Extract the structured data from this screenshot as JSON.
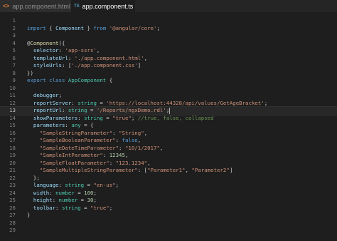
{
  "tabs": [
    {
      "label": "app.component.html",
      "icon": "html-file-icon",
      "icon_glyph": "<>",
      "active": false
    },
    {
      "label": "app.component.ts",
      "icon": "typescript-file-icon",
      "icon_glyph": "TS",
      "active": true
    }
  ],
  "editor": {
    "current_line": 13,
    "lines": [
      {
        "n": "1",
        "tokens": []
      },
      {
        "n": "2",
        "tokens": [
          {
            "t": "import",
            "c": "kw"
          },
          {
            "t": " { ",
            "c": ""
          },
          {
            "t": "Component",
            "c": "prop"
          },
          {
            "t": " } ",
            "c": ""
          },
          {
            "t": "from",
            "c": "kw"
          },
          {
            "t": " ",
            "c": ""
          },
          {
            "t": "'@angular/core'",
            "c": "str"
          },
          {
            "t": ";",
            "c": ""
          }
        ]
      },
      {
        "n": "3",
        "tokens": []
      },
      {
        "n": "4",
        "tokens": [
          {
            "t": "@",
            "c": ""
          },
          {
            "t": "Component",
            "c": "dec"
          },
          {
            "t": "({",
            "c": ""
          }
        ]
      },
      {
        "n": "5",
        "tokens": [
          {
            "t": "  selector",
            "c": "prop"
          },
          {
            "t": ": ",
            "c": ""
          },
          {
            "t": "'app-ssrs'",
            "c": "str"
          },
          {
            "t": ",",
            "c": ""
          }
        ]
      },
      {
        "n": "6",
        "tokens": [
          {
            "t": "  templateUrl",
            "c": "prop"
          },
          {
            "t": ": ",
            "c": ""
          },
          {
            "t": "'./app.component.html'",
            "c": "str"
          },
          {
            "t": ",",
            "c": ""
          }
        ]
      },
      {
        "n": "7",
        "tokens": [
          {
            "t": "  styleUrls",
            "c": "prop"
          },
          {
            "t": ": [",
            "c": ""
          },
          {
            "t": "'./app.component.css'",
            "c": "str"
          },
          {
            "t": "]",
            "c": ""
          }
        ]
      },
      {
        "n": "8",
        "tokens": [
          {
            "t": "})",
            "c": ""
          }
        ]
      },
      {
        "n": "9",
        "tokens": [
          {
            "t": "export",
            "c": "kw"
          },
          {
            "t": " ",
            "c": ""
          },
          {
            "t": "class",
            "c": "kw"
          },
          {
            "t": " ",
            "c": ""
          },
          {
            "t": "AppComponent",
            "c": "cls"
          },
          {
            "t": " {",
            "c": ""
          }
        ]
      },
      {
        "n": "10",
        "tokens": []
      },
      {
        "n": "11",
        "tokens": [
          {
            "t": "  debugger",
            "c": "prop"
          },
          {
            "t": ";",
            "c": ""
          }
        ]
      },
      {
        "n": "12",
        "tokens": [
          {
            "t": "  reportServer",
            "c": "prop"
          },
          {
            "t": ": ",
            "c": ""
          },
          {
            "t": "string",
            "c": "cls"
          },
          {
            "t": " = ",
            "c": ""
          },
          {
            "t": "'https://localhost:44328/api/values/GetAgeBracket'",
            "c": "str"
          },
          {
            "t": ";",
            "c": ""
          }
        ]
      },
      {
        "n": "13",
        "tokens": [
          {
            "t": "  reportUrl",
            "c": "prop"
          },
          {
            "t": ": ",
            "c": ""
          },
          {
            "t": "string",
            "c": "cls"
          },
          {
            "t": " = ",
            "c": ""
          },
          {
            "t": "'/Reports/ngxDemo.rdl'",
            "c": "str"
          },
          {
            "t": ";",
            "c": ""
          }
        ]
      },
      {
        "n": "14",
        "tokens": [
          {
            "t": "  showParameters",
            "c": "prop"
          },
          {
            "t": ": ",
            "c": ""
          },
          {
            "t": "string",
            "c": "cls"
          },
          {
            "t": " = ",
            "c": ""
          },
          {
            "t": "\"true\"",
            "c": "str"
          },
          {
            "t": "; ",
            "c": ""
          },
          {
            "t": "//true, false, collapsed",
            "c": "cmt"
          }
        ]
      },
      {
        "n": "15",
        "tokens": [
          {
            "t": "  parameters",
            "c": "prop"
          },
          {
            "t": ": ",
            "c": ""
          },
          {
            "t": "any",
            "c": "cls"
          },
          {
            "t": " = {",
            "c": ""
          }
        ]
      },
      {
        "n": "16",
        "tokens": [
          {
            "t": "    \"SampleStringParameter\"",
            "c": "str"
          },
          {
            "t": ": ",
            "c": ""
          },
          {
            "t": "\"String\"",
            "c": "str"
          },
          {
            "t": ",",
            "c": ""
          }
        ]
      },
      {
        "n": "17",
        "tokens": [
          {
            "t": "    \"SampleBooleanParameter\"",
            "c": "str"
          },
          {
            "t": ": ",
            "c": ""
          },
          {
            "t": "false",
            "c": "kw"
          },
          {
            "t": ",",
            "c": ""
          }
        ]
      },
      {
        "n": "18",
        "tokens": [
          {
            "t": "    \"SampleDateTimeParameter\"",
            "c": "str"
          },
          {
            "t": ": ",
            "c": ""
          },
          {
            "t": "\"10/1/2017\"",
            "c": "str"
          },
          {
            "t": ",",
            "c": ""
          }
        ]
      },
      {
        "n": "19",
        "tokens": [
          {
            "t": "    \"SampleIntParameter\"",
            "c": "str"
          },
          {
            "t": ": ",
            "c": ""
          },
          {
            "t": "12345",
            "c": "num"
          },
          {
            "t": ",",
            "c": ""
          }
        ]
      },
      {
        "n": "20",
        "tokens": [
          {
            "t": "    \"SampleFloatParameter\"",
            "c": "str"
          },
          {
            "t": ": ",
            "c": ""
          },
          {
            "t": "\"123.1234\"",
            "c": "str"
          },
          {
            "t": ",",
            "c": ""
          }
        ]
      },
      {
        "n": "21",
        "tokens": [
          {
            "t": "    \"SampleMultipleStringParameter\"",
            "c": "str"
          },
          {
            "t": ": [",
            "c": ""
          },
          {
            "t": "\"Parameter1\"",
            "c": "str"
          },
          {
            "t": ", ",
            "c": ""
          },
          {
            "t": "\"Parameter2\"",
            "c": "str"
          },
          {
            "t": "]",
            "c": ""
          }
        ]
      },
      {
        "n": "22",
        "tokens": [
          {
            "t": "  };",
            "c": ""
          }
        ]
      },
      {
        "n": "23",
        "tokens": [
          {
            "t": "  language",
            "c": "prop"
          },
          {
            "t": ": ",
            "c": ""
          },
          {
            "t": "string",
            "c": "cls"
          },
          {
            "t": " = ",
            "c": ""
          },
          {
            "t": "\"en-us\"",
            "c": "str"
          },
          {
            "t": ";",
            "c": ""
          }
        ]
      },
      {
        "n": "24",
        "tokens": [
          {
            "t": "  width",
            "c": "prop"
          },
          {
            "t": ": ",
            "c": ""
          },
          {
            "t": "number",
            "c": "cls"
          },
          {
            "t": " = ",
            "c": ""
          },
          {
            "t": "100",
            "c": "num"
          },
          {
            "t": ";",
            "c": ""
          }
        ]
      },
      {
        "n": "25",
        "tokens": [
          {
            "t": "  height",
            "c": "prop"
          },
          {
            "t": ": ",
            "c": ""
          },
          {
            "t": "number",
            "c": "cls"
          },
          {
            "t": " = ",
            "c": ""
          },
          {
            "t": "30",
            "c": "num"
          },
          {
            "t": ";",
            "c": ""
          }
        ]
      },
      {
        "n": "26",
        "tokens": [
          {
            "t": "  toolbar",
            "c": "prop"
          },
          {
            "t": ": ",
            "c": ""
          },
          {
            "t": "string",
            "c": "cls"
          },
          {
            "t": " = ",
            "c": ""
          },
          {
            "t": "\"true\"",
            "c": "str"
          },
          {
            "t": ";",
            "c": ""
          }
        ]
      },
      {
        "n": "27",
        "tokens": [
          {
            "t": "}",
            "c": ""
          }
        ]
      },
      {
        "n": "28",
        "tokens": []
      },
      {
        "n": "29",
        "tokens": []
      }
    ]
  }
}
